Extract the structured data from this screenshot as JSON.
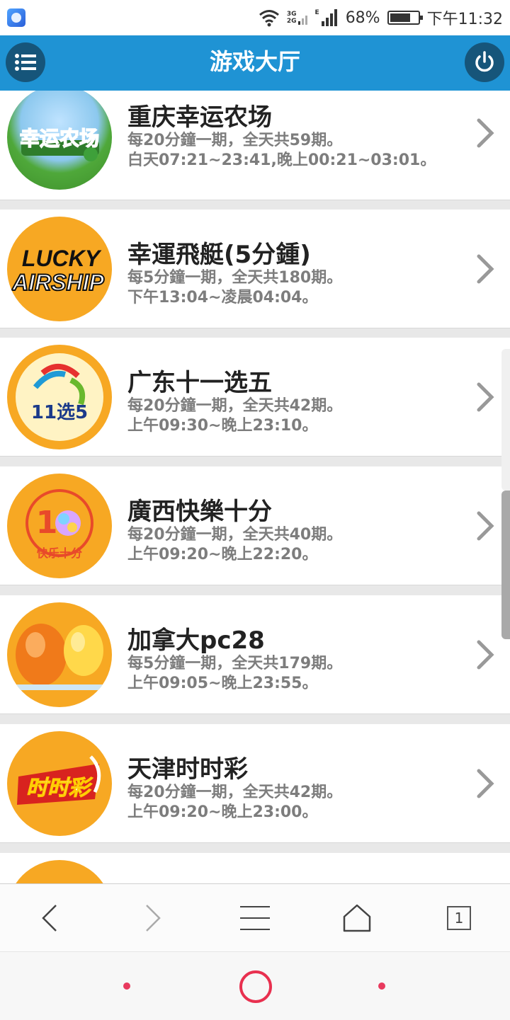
{
  "status_bar": {
    "network_top": "3G",
    "network_bottom": "2G",
    "network_e": "E",
    "battery": "68%",
    "time": "下午11:32"
  },
  "header": {
    "title": "游戏大厅",
    "menu_icon": "list-menu-icon",
    "power_icon": "power-icon",
    "color": "#1f93d4"
  },
  "games": [
    {
      "name": "重庆幸运农场",
      "schedule": "每20分鐘一期，全天共59期。",
      "hours": "白天07:21~23:41,晚上00:21~03:01。",
      "logo_text": "幸运农场"
    },
    {
      "name": "幸運飛艇(5分鍾)",
      "schedule": "每5分鐘一期，全天共180期。",
      "hours": "下午13:04~凌晨04:04。",
      "logo_text": "LUCKY AIRSHIP"
    },
    {
      "name": "广东十一选五",
      "schedule": "每20分鐘一期，全天共42期。",
      "hours": "上午09:30~晚上23:10。",
      "logo_text": "11选5"
    },
    {
      "name": "廣西快樂十分",
      "schedule": "每20分鐘一期，全天共40期。",
      "hours": "上午09:20~晚上22:20。",
      "logo_text": "快乐十分"
    },
    {
      "name": "加拿大pc28",
      "schedule": "每5分鐘一期，全天共179期。",
      "hours": "上午09:05~晚上23:55。",
      "logo_text": ""
    },
    {
      "name": "天津时时彩",
      "schedule": "每20分鐘一期，全天共42期。",
      "hours": "上午09:20~晚上23:00。",
      "logo_text": "时时彩"
    }
  ],
  "browser_bar": {
    "tab_count": "1"
  }
}
